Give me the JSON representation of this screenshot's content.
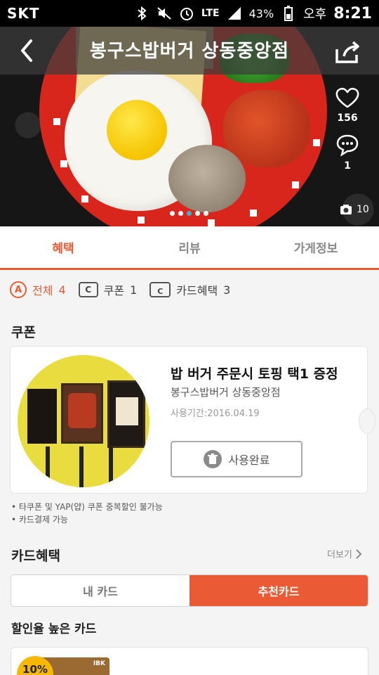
{
  "status_bar": {
    "carrier": "SKT",
    "battery": "43%",
    "network": "LTE",
    "ampm": "오후",
    "time": "8:21"
  },
  "header": {
    "title": "봉구스밥버거 상동중앙점",
    "likes_count": "156",
    "comments_count": "1",
    "photo_count": "10",
    "carousel_pages": 5,
    "carousel_active_index": 2
  },
  "tabs": [
    {
      "label": "혜택",
      "active": true
    },
    {
      "label": "리뷰",
      "active": false
    },
    {
      "label": "가게정보",
      "active": false
    }
  ],
  "filters": {
    "all_badge": "A",
    "all_label": "전체",
    "all_count": "4",
    "coupon_badge": "C",
    "coupon_label": "쿠폰",
    "coupon_count": "1",
    "card_badge": "C",
    "card_label": "카드혜택",
    "card_count": "3"
  },
  "coupon_section": {
    "title": "쿠폰",
    "coupon": {
      "title": "밥 버거 주문시 토핑 택1 증정",
      "store": "봉구스밥버거 상동중앙점",
      "period": "사용기간:2016.04.19",
      "button_label": "사용완료"
    },
    "notes": [
      "• 타쿠폰 및 YAP(얍) 쿠폰 중복할인 불가능",
      "• 카드결제 가능"
    ]
  },
  "card_section": {
    "title": "카드혜택",
    "more_label": "더보기",
    "segments": [
      {
        "label": "내 카드",
        "active": false
      },
      {
        "label": "추천카드",
        "active": true
      }
    ],
    "subtitle": "할인율 높은 카드",
    "first_card": {
      "discount": "10%",
      "brand": "IBK"
    }
  },
  "colors": {
    "accent": "#ea5a35",
    "carousel_active_dot": "#3cb3c8",
    "discount_badge": "#f6b800"
  }
}
